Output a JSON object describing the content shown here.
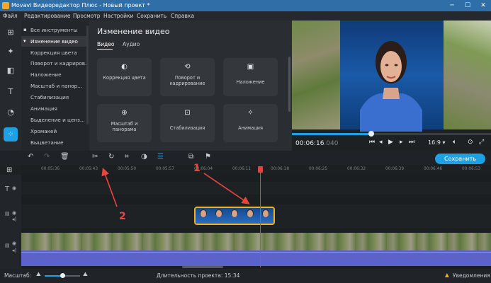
{
  "window": {
    "title": "Movavi Видеоредактор Плюс - Новый проект *",
    "minimize": "─",
    "maximize": "☐",
    "close": "✕"
  },
  "menu": [
    "Файл",
    "Редактирование",
    "Просмотр",
    "Настройки",
    "Сохранить",
    "Справка"
  ],
  "tools": {
    "header": "Все инструменты",
    "selected": "Изменение видео",
    "items": [
      "Коррекция цвета",
      "Поворот и кадриров...",
      "Наложение",
      "Масштаб и панор...",
      "Стабилизация",
      "Анимация",
      "Выделение и ценз...",
      "Хромакей",
      "Выцветание"
    ]
  },
  "panel": {
    "title": "Изменение видео",
    "tabs": [
      "Видео",
      "Аудио"
    ],
    "cards": [
      "Коррекция цвета",
      "Поворот и кадрирование",
      "Наложение",
      "Масштаб и панорама",
      "Стабилизация",
      "Анимация"
    ]
  },
  "player": {
    "timecode": "00:06:16",
    "timecode_ms": ".040",
    "progress": 0.4,
    "ratio": "16:9 ▾"
  },
  "timeline": {
    "save_label": "Сохранить",
    "ruler": [
      "00:05:36",
      "00:05:43",
      "00:05:50",
      "00:05:57",
      "00:06:04",
      "00:06:11",
      "00:06:18",
      "00:06:25",
      "00:06:32",
      "00:06:39",
      "00:06:46",
      "00:06:53"
    ]
  },
  "status": {
    "zoom_label": "Масштаб:",
    "duration": "Длительность проекта: 15:34",
    "notifications": "Уведомления",
    "zoom_level": 0.5
  },
  "annotations": [
    "1",
    "2"
  ],
  "colors": {
    "accent": "#1ea0e4",
    "clip_border": "#f2b11c",
    "playhead": "#e0443e",
    "annotation": "#e8473d",
    "audio": "#5b62c9"
  }
}
